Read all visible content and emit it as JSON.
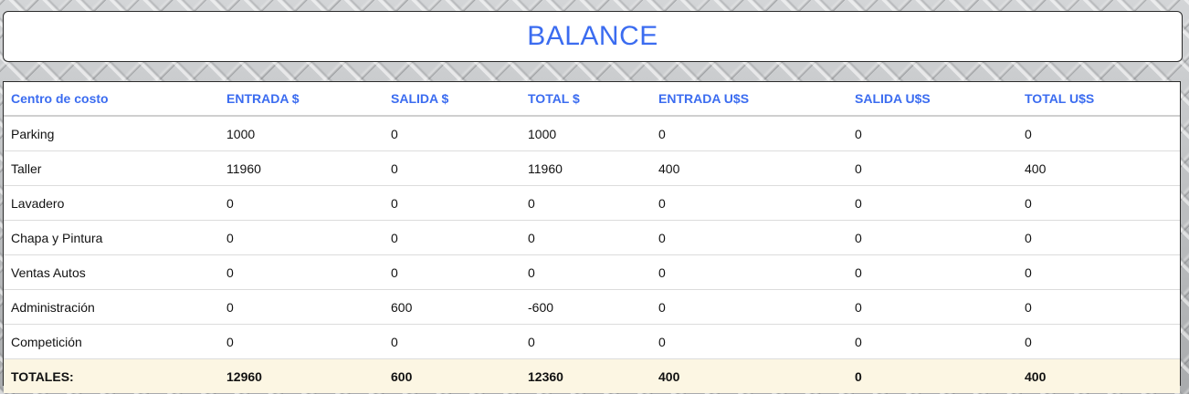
{
  "header": {
    "title": "BALANCE"
  },
  "table": {
    "columns": [
      "Centro de costo",
      "ENTRADA $",
      "SALIDA $",
      "TOTAL $",
      "ENTRADA U$S",
      "SALIDA U$S",
      "TOTAL U$S"
    ],
    "rows": [
      [
        "Parking",
        "1000",
        "0",
        "1000",
        "0",
        "0",
        "0"
      ],
      [
        "Taller",
        "11960",
        "0",
        "11960",
        "400",
        "0",
        "400"
      ],
      [
        "Lavadero",
        "0",
        "0",
        "0",
        "0",
        "0",
        "0"
      ],
      [
        "Chapa y Pintura",
        "0",
        "0",
        "0",
        "0",
        "0",
        "0"
      ],
      [
        "Ventas Autos",
        "0",
        "0",
        "0",
        "0",
        "0",
        "0"
      ],
      [
        "Administración",
        "0",
        "600",
        "-600",
        "0",
        "0",
        "0"
      ],
      [
        "Competición",
        "0",
        "0",
        "0",
        "0",
        "0",
        "0"
      ]
    ],
    "totals": [
      "TOTALES:",
      "12960",
      "600",
      "12360",
      "400",
      "0",
      "400"
    ]
  },
  "colors": {
    "accent": "#3b6cf0",
    "totals_background": "#fcf6e3"
  }
}
